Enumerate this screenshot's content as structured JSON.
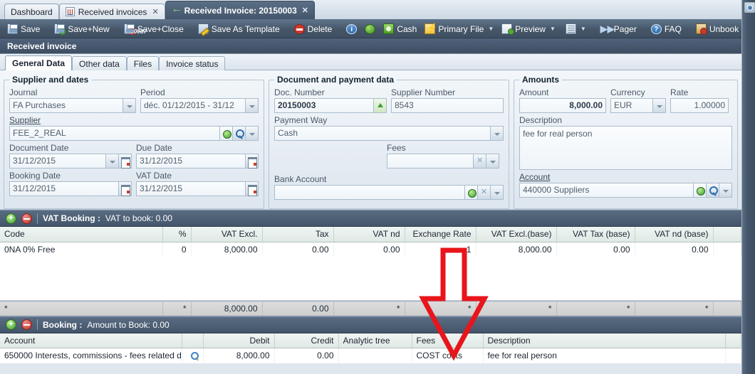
{
  "window": {
    "tabs": [
      {
        "label": "Dashboard",
        "icon": "none",
        "closable": false,
        "active": false
      },
      {
        "label": "Received invoices",
        "icon": "report-icon",
        "closable": true,
        "active": false
      },
      {
        "label": "Received Invoice: 20150003",
        "icon": "arrow-left-icon",
        "closable": true,
        "active": true
      }
    ],
    "close_glyph": "✕"
  },
  "toolbar": {
    "left": [
      {
        "label": "Save",
        "icon": "save-icon"
      },
      {
        "label": "Save+New",
        "icon": "save-new-icon"
      },
      {
        "label": "Save+Close",
        "icon": "save-close-icon"
      },
      {
        "label": "Save As Template",
        "icon": "save-template-icon"
      },
      {
        "label": "Delete",
        "icon": "delete-icon"
      }
    ],
    "middle": [
      {
        "label": "",
        "icon": "info-icon"
      },
      {
        "label": "",
        "icon": "globe-icon"
      },
      {
        "label": "Cash",
        "icon": "cash-icon"
      },
      {
        "label": "Primary File",
        "icon": "primary-file-icon",
        "caret": true
      },
      {
        "label": "Preview",
        "icon": "preview-icon",
        "caret": true
      }
    ],
    "right": [
      {
        "label": "",
        "icon": "grid-options-icon",
        "caret": true
      },
      {
        "label": "Pager",
        "icon": "pager-icon"
      },
      {
        "label": "FAQ",
        "icon": "faq-icon"
      },
      {
        "label": "Unbook Invoice",
        "icon": "unbook-icon"
      }
    ]
  },
  "page": {
    "title": "Received invoice",
    "subtabs": [
      {
        "label": "General Data",
        "active": true
      },
      {
        "label": "Other data",
        "active": false
      },
      {
        "label": "Files",
        "active": false
      },
      {
        "label": "Invoice status",
        "active": false
      }
    ]
  },
  "supplier_group": {
    "legend": "Supplier and dates",
    "journal": {
      "label": "Journal",
      "value": "FA Purchases"
    },
    "period": {
      "label": "Period",
      "value": "déc. 01/12/2015 - 31/12"
    },
    "supplier": {
      "label": "Supplier",
      "value": "FEE_2_REAL"
    },
    "document_date": {
      "label": "Document Date",
      "value": "31/12/2015"
    },
    "due_date": {
      "label": "Due Date",
      "value": "31/12/2015"
    },
    "booking_date": {
      "label": "Booking Date",
      "value": "31/12/2015"
    },
    "vat_date": {
      "label": "VAT Date",
      "value": "31/12/2015"
    }
  },
  "document_group": {
    "legend": "Document and payment data",
    "doc_number": {
      "label": "Doc. Number",
      "value": "20150003"
    },
    "supplier_number": {
      "label": "Supplier Number",
      "value": "8543"
    },
    "payment_way": {
      "label": "Payment Way",
      "value": "Cash"
    },
    "fees": {
      "label": "Fees",
      "value": ""
    },
    "bank_account": {
      "label": "Bank Account",
      "value": ""
    }
  },
  "amounts_group": {
    "legend": "Amounts",
    "amount": {
      "label": "Amount",
      "value": "8,000.00"
    },
    "currency": {
      "label": "Currency",
      "value": "EUR"
    },
    "rate": {
      "label": "Rate",
      "value": "1.00000"
    },
    "description": {
      "label": "Description",
      "value": "fee for real person"
    },
    "account": {
      "label": "Account",
      "value": "440000 Suppliers"
    }
  },
  "vat_section": {
    "title": "VAT Booking :",
    "subtitle": "VAT to book: 0.00",
    "columns": [
      "Code",
      "%",
      "VAT Excl.",
      "Tax",
      "VAT nd",
      "Exchange Rate",
      "VAT Excl.(base)",
      "VAT Tax (base)",
      "VAT nd (base)"
    ],
    "rows": [
      [
        "0NA 0% Free",
        "0",
        "8,000.00",
        "0.00",
        "0.00",
        "1",
        "8,000.00",
        "0.00",
        "0.00"
      ]
    ],
    "footer": [
      "*",
      "*",
      "8,000.00",
      "0.00",
      "*",
      "*",
      "*",
      "*",
      "*"
    ]
  },
  "booking_section": {
    "title": "Booking :",
    "subtitle": "Amount to Book: 0.00",
    "columns": [
      "Account",
      "",
      "Debit",
      "Credit",
      "Analytic tree",
      "Fees",
      "Description"
    ],
    "rows": [
      [
        "650000 Interests, commissions - fees related d...",
        "search-icon",
        "8,000.00",
        "0.00",
        "",
        "COST costs",
        "fee for real person"
      ]
    ]
  },
  "annotation": {
    "arrow_color": "#e8151b",
    "arrow_target": "Fees column of Booking grid"
  }
}
